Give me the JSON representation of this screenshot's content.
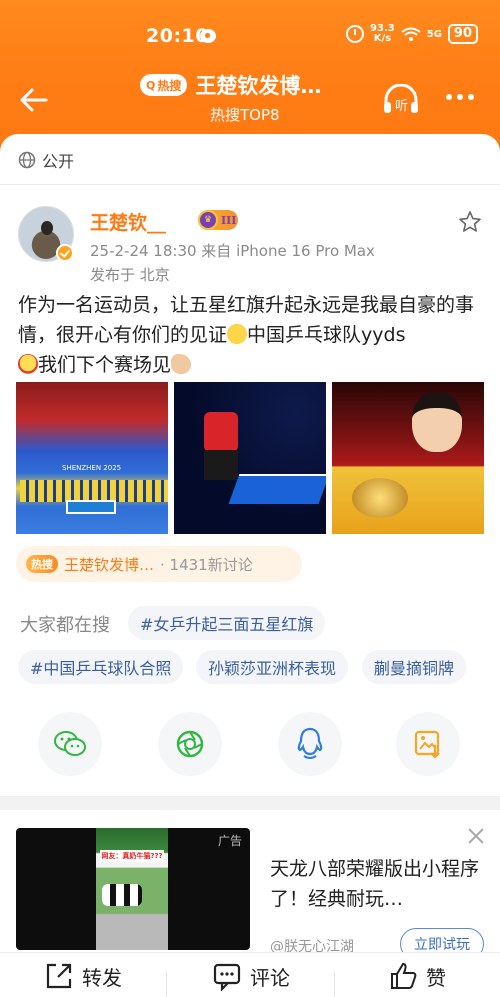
{
  "status_bar": {
    "time": "20:10",
    "net_speed_top": "93.3",
    "net_speed_bottom": "K/s",
    "signal": "5G",
    "battery": "90"
  },
  "nav": {
    "hot_badge": "热搜",
    "title": "王楚钦发博…",
    "subtitle": "热搜TOP8",
    "listen_label": "听"
  },
  "visibility": "公开",
  "post": {
    "username": "王楚钦__",
    "level": "III",
    "meta": "25-2-24 18:30  来自 iPhone 16 Pro Max",
    "location": "发布于 北京",
    "text_part1": "作为一名运动员，让五星红旗升起永远是我最自豪的事情，很开心有你们的见证",
    "text_part2": "中国乒乓球队yyds",
    "text_part3": "我们下个赛场见",
    "photo_captions": [
      "SHENZHEN 2025"
    ],
    "topic": {
      "badge": "热搜",
      "name": "王楚钦发博…",
      "count": "· 1431新讨论"
    }
  },
  "search": {
    "label": "大家都在搜",
    "chips": [
      "#女乒升起三面五星红旗",
      "#中国乒乓球队合照",
      "孙颖莎亚洲杯表现",
      "蒯曼摘铜牌"
    ]
  },
  "share": {
    "icons": [
      "wechat-icon",
      "moments-icon",
      "qq-icon",
      "save-image-icon"
    ]
  },
  "ad": {
    "tag": "广告",
    "video_caption": "网友：真奶牛猫???",
    "title": "天龙八部荣耀版出小程序了！经典耐玩…",
    "source": "@朕无心江湖",
    "cta": "立即试玩"
  },
  "bottom_bar": {
    "repost": "转发",
    "comment": "评论",
    "like": "赞"
  },
  "colors": {
    "brand_orange": "#ff7b14",
    "link_blue": "#3a5fa0"
  }
}
